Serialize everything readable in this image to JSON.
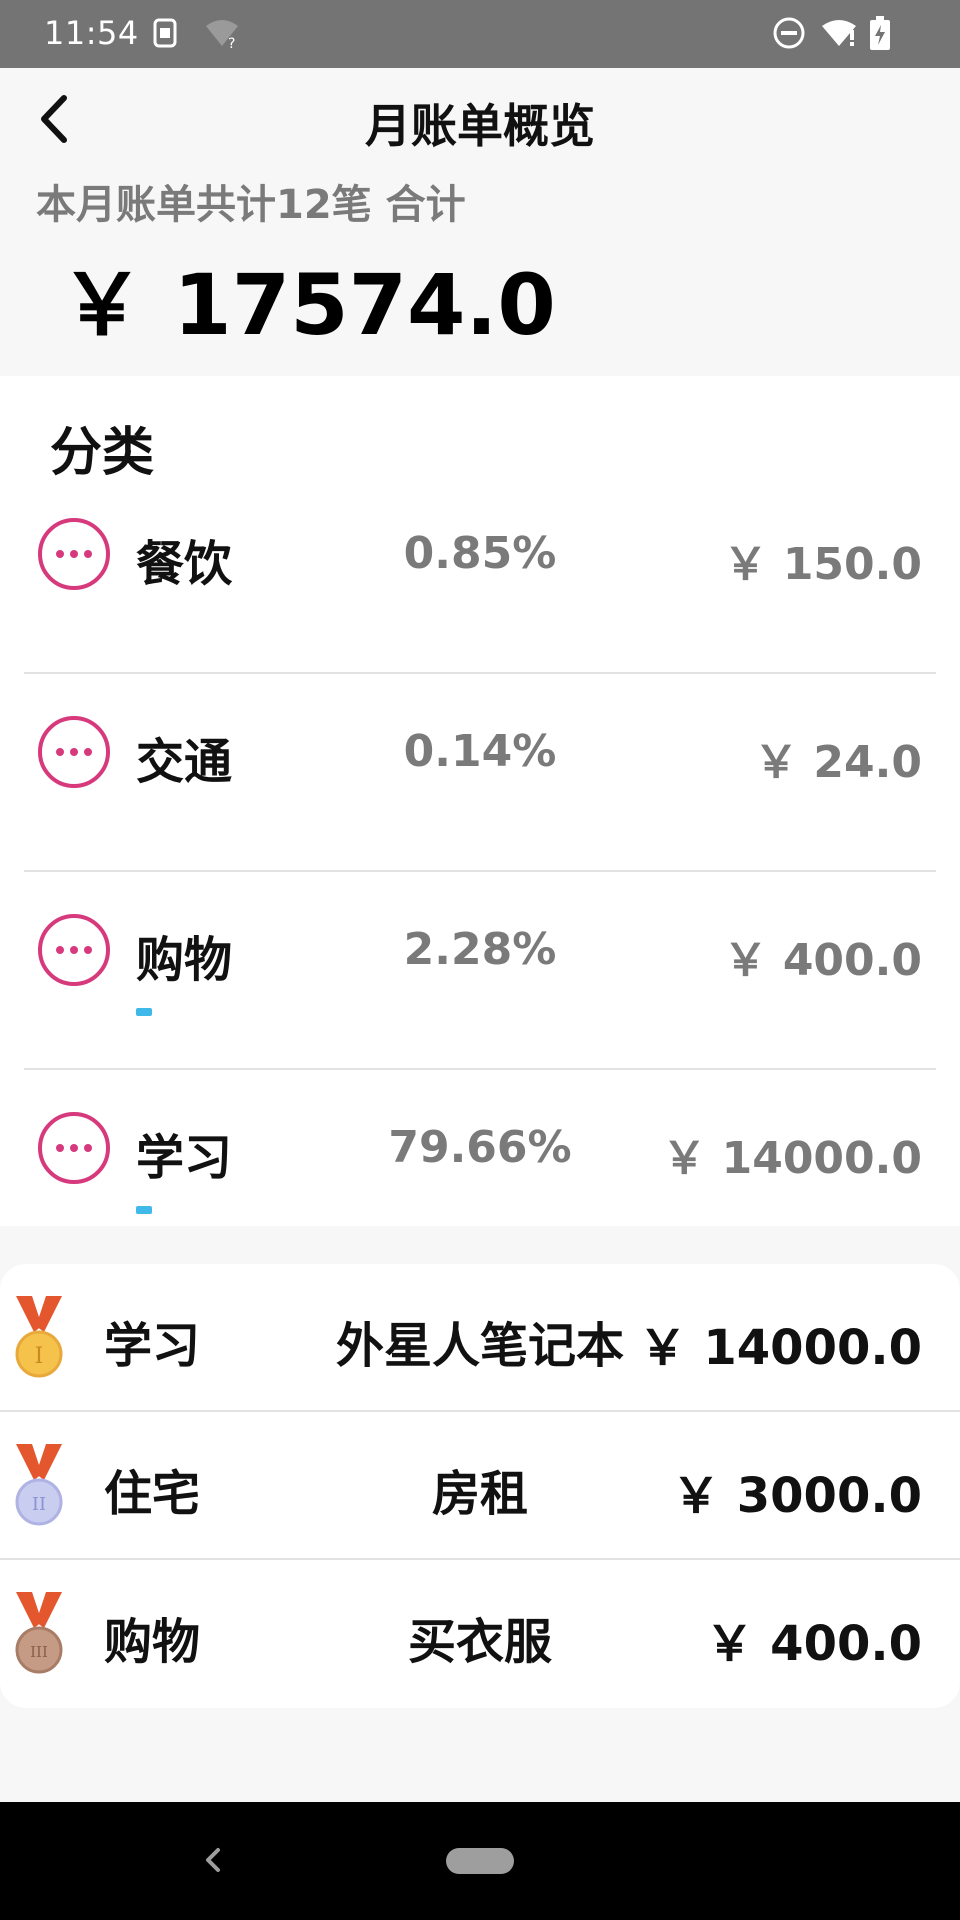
{
  "status_bar": {
    "time": "11:54",
    "icons": [
      "sim-icon",
      "wifi-question-icon",
      "dnd-icon",
      "wifi-alert-icon",
      "battery-charging-icon"
    ]
  },
  "header": {
    "back_icon": "chevron-left-icon",
    "title": "月账单概览",
    "summary": "本月账单共计12笔 合计",
    "total": "￥ 17574.0"
  },
  "categories": {
    "heading": "分类",
    "items": [
      {
        "icon": "more-circle-icon",
        "name": "餐饮",
        "percent": "0.85%",
        "amount": "￥ 150.0",
        "share": 0.0085
      },
      {
        "icon": "more-circle-icon",
        "name": "交通",
        "percent": "0.14%",
        "amount": "￥ 24.0",
        "share": 0.0014
      },
      {
        "icon": "more-circle-icon",
        "name": "购物",
        "percent": "2.28%",
        "amount": "￥ 400.0",
        "share": 0.0228
      },
      {
        "icon": "more-circle-icon",
        "name": "学习",
        "percent": "79.66%",
        "amount": "￥ 14000.0",
        "share": 0.7966
      }
    ]
  },
  "ranking": [
    {
      "medal": "gold-medal-icon",
      "category": "学习",
      "description": "外星人笔记本",
      "amount": "￥ 14000.0"
    },
    {
      "medal": "silver-medal-icon",
      "category": "住宅",
      "description": "房租",
      "amount": "￥ 3000.0"
    },
    {
      "medal": "bronze-medal-icon",
      "category": "购物",
      "description": "买衣服",
      "amount": "￥ 400.0"
    }
  ],
  "colors": {
    "accent_pink": "#d63a7c",
    "bar_blue": "#3fb8ea",
    "status_bar": "#747474",
    "nav_bar": "#000000"
  }
}
